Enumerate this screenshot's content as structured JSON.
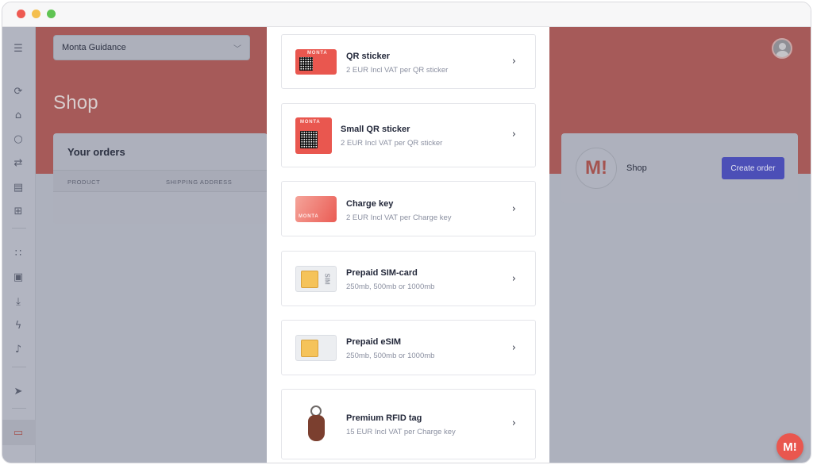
{
  "window": {
    "controls": [
      "close",
      "minimize",
      "maximize"
    ]
  },
  "sidebar": {
    "icons": [
      "menu-icon",
      "refresh-icon",
      "home-icon",
      "lightbulb-icon",
      "transfer-icon",
      "documents-icon",
      "gift-icon",
      "grid-icon",
      "charger-icon",
      "download-icon",
      "lightning-icon",
      "bell-icon",
      "send-icon",
      "shop-icon"
    ],
    "active": "shop-icon"
  },
  "header": {
    "org_select": "Monta Guidance",
    "title": "Shop"
  },
  "orders": {
    "title": "Your orders",
    "columns": [
      "PRODUCT",
      "SHIPPING ADDRESS"
    ]
  },
  "shop": {
    "logo_text": "M!",
    "name": "Shop",
    "create_button": "Create order"
  },
  "products": [
    {
      "name": "QR sticker",
      "desc": "2 EUR Incl VAT per QR sticker"
    },
    {
      "name": "Small QR sticker",
      "desc": "2 EUR Incl VAT per QR sticker"
    },
    {
      "name": "Charge key",
      "desc": "2 EUR Incl VAT per Charge key"
    },
    {
      "name": "Prepaid SIM-card",
      "desc": "250mb, 500mb or 1000mb"
    },
    {
      "name": "Prepaid eSIM",
      "desc": "250mb, 500mb or 1000mb"
    },
    {
      "name": "Premium RFID tag",
      "desc": "15 EUR Incl VAT per Charge key"
    }
  ],
  "thumb_labels": {
    "brand": "MONTA",
    "sim": "SIM"
  },
  "fab": {
    "label": "M!"
  },
  "colors": {
    "brand_red": "#e9574f",
    "button_blue": "#4c4fb7"
  }
}
